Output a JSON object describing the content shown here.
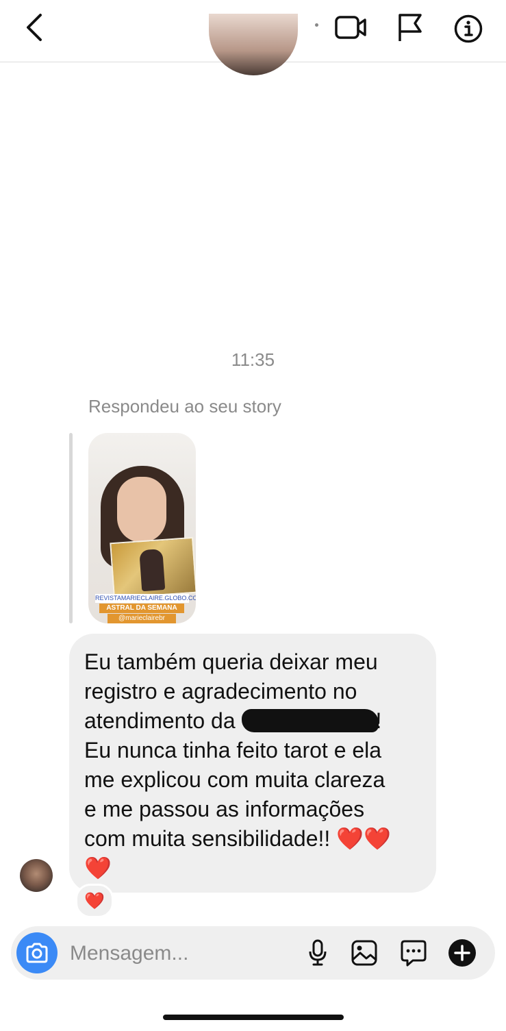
{
  "header": {
    "back_icon": "chevron-left-icon",
    "video_icon": "video-call-icon",
    "flag_icon": "flag-icon",
    "info_icon": "info-icon"
  },
  "thread": {
    "timestamp": "11:35",
    "reply_note": "Respondeu ao seu story",
    "story": {
      "url": "REVISTAMARIECLAIRE.GLOBO.COM",
      "tag": "ASTRAL DA SEMANA",
      "handle": "@marieclairebr"
    },
    "message": {
      "line1": "Eu também queria deixar meu",
      "line2": "registro e agradecimento no",
      "line3_prefix": "atendimento da ",
      "line3_suffix": "!",
      "line4": "Eu nunca tinha feito tarot e ela",
      "line5": "me explicou com muita clareza",
      "line6": "e me passou as informações",
      "line7": "com muita sensibilidade!! ",
      "line7_hearts": "❤️❤️",
      "line8": "❤️"
    },
    "reaction": "❤️"
  },
  "composer": {
    "placeholder": "Mensagem...",
    "camera_icon": "camera-icon",
    "mic_icon": "microphone-icon",
    "gallery_icon": "image-gallery-icon",
    "sticker_icon": "sticker-chat-icon",
    "plus_icon": "plus-circle-icon"
  },
  "colors": {
    "accent": "#3b8af6",
    "bubble": "#efefef",
    "heart": "#e0283a",
    "muted_text": "#8a8a8a"
  }
}
